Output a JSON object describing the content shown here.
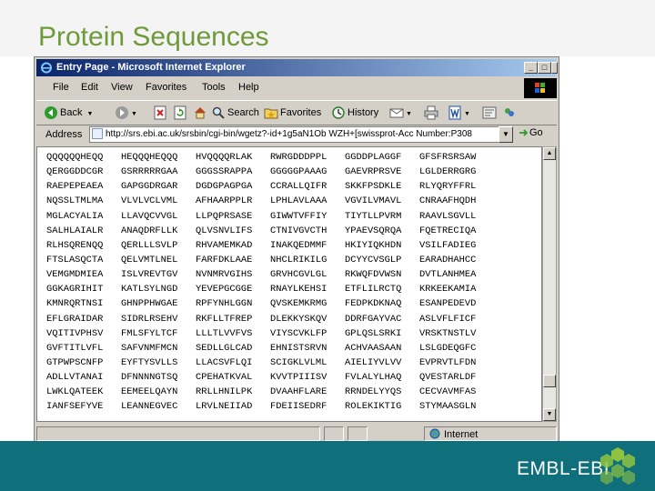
{
  "slide": {
    "title": "Protein Sequences",
    "brand": "EMBL-EBI"
  },
  "window": {
    "title": "Entry Page - Microsoft Internet Explorer",
    "minimize_label": "_",
    "maximize_label": "□",
    "close_label": "×"
  },
  "menu": [
    "File",
    "Edit",
    "View",
    "Favorites",
    "Tools",
    "Help"
  ],
  "toolbar": {
    "back": "Back",
    "search": "Search",
    "favorites": "Favorites",
    "history": "History"
  },
  "address": {
    "label": "Address",
    "url": "http://srs.ebi.ac.uk/srsbin/cgi-bin/wgetz?-id+1g5aN1Ob WZH+[swissprot-Acc Number:P308",
    "go": "Go"
  },
  "status": {
    "zone": "Internet"
  },
  "sequence_rows": [
    [
      "QQQQQQHEQQ",
      "HEQQQHEQQQ",
      "HVQQQQRLAK",
      "RWRGDDDPPL",
      "GGDDPLAGGF",
      "GFSFRSRSAW"
    ],
    [
      "QERGGDDCGR",
      "GSRRRRRGAA",
      "GGGSSRAPPA",
      "GGGGGPAAAG",
      "GAEVRPRSVE",
      "LGLDERRGRG"
    ],
    [
      "RAEPEPEAEA",
      "GAPGGDRGAR",
      "DGDGPAGPGA",
      "CCRALLQIFR",
      "SKKFPSDKLE",
      "RLYQRYFFRL"
    ],
    [
      "NQSSLTMLMA",
      "VLVLVCLVML",
      "AFHAARPPLR",
      "LPHLAVLAAA",
      "VGVILVMAVL",
      "CNRAAFHQDH"
    ],
    [
      "MGLACYALIA",
      "LLAVQCVVGL",
      "LLPQPRSASE",
      "GIWWTVFFIY",
      "TIYTLLPVRM",
      "RAAVLSGVLL"
    ],
    [
      "SALHLAIALR",
      "ANAQDRFLLK",
      "QLVSNVLIFS",
      "CTNIVGVCTH",
      "YPAEVSQRQA",
      "FQETRECIQA"
    ],
    [
      "RLHSQRENQQ",
      "QERLLLSVLP",
      "RHVAMEMKAD",
      "INAKQEDMMF",
      "HKIYIQKHDN",
      "VSILFADIEG"
    ],
    [
      "FTSLASQCTA",
      "QELVMTLNEL",
      "FARFDKLAAE",
      "NHCLRIKILG",
      "DCYYCVSGLP",
      "EARADHAHCC"
    ],
    [
      "VEMGMDMIEA",
      "ISLVREVTGV",
      "NVNMRVGIHS",
      "GRVHCGVLGL",
      "RKWQFDVWSN",
      "DVTLANHMEA"
    ],
    [
      "GGKAGRIHIT",
      "KATLSYLNGD",
      "YEVEPGCGGE",
      "RNAYLKEHSI",
      "ETFLILRCTQ",
      "KRKEEKAMIA"
    ],
    [
      "KMNRQRTNSI",
      "GHNPPHWGAE",
      "RPFYNHLGGN",
      "QVSKEMKRMG",
      "FEDPKDKNAQ",
      "ESANPEDEVD"
    ],
    [
      "EFLGRAIDAR",
      "SIDRLRSEHV",
      "RKFLLTFREP",
      "DLEKKYSKQV",
      "DDRFGAYVAC",
      "ASLVFLFICF"
    ],
    [
      "VQITIVPHSV",
      "FMLSFYLTCF",
      "LLLTLVVFVS",
      "VIYSCVKLFP",
      "GPLQSLSRKI",
      "VRSKTNSTLV"
    ],
    [
      "GVFTITLVFL",
      "SAFVNMFMCN",
      "SEDLLGLCAD",
      "EHNISTSRVN",
      "ACHVAASAAN",
      "LSLGDEQGFC"
    ],
    [
      "GTPWPSCNFP",
      "EYFTYSVLLS",
      "LLACSVFLQI",
      "SCIGKLVLML",
      "AIELIYVLVV",
      "EVPRVTLFDN"
    ],
    [
      "ADLLVTANAI",
      "DFNNNNGTSQ",
      "CPEHATKVAL",
      "KVVTPIIISV",
      "FVLALYLHAQ",
      "QVESTARLDF"
    ],
    [
      "LWKLQATEEK",
      "EEMEELQAYN",
      "RRLLHNILPK",
      "DVAAHFLARE",
      "RRNDELYYQS",
      "CECVAVMFAS"
    ],
    [
      "IANFSEFYVE",
      "LEANNEGVEC",
      "LRVLNEIIAD",
      "FDEIISEDRF",
      "ROLEKIKTIG",
      "STYMAASGLN"
    ]
  ],
  "colors": {
    "slide_title": "#6f9a3a",
    "footer_band": "#0f6f7a",
    "titlebar": "#0a246a"
  }
}
